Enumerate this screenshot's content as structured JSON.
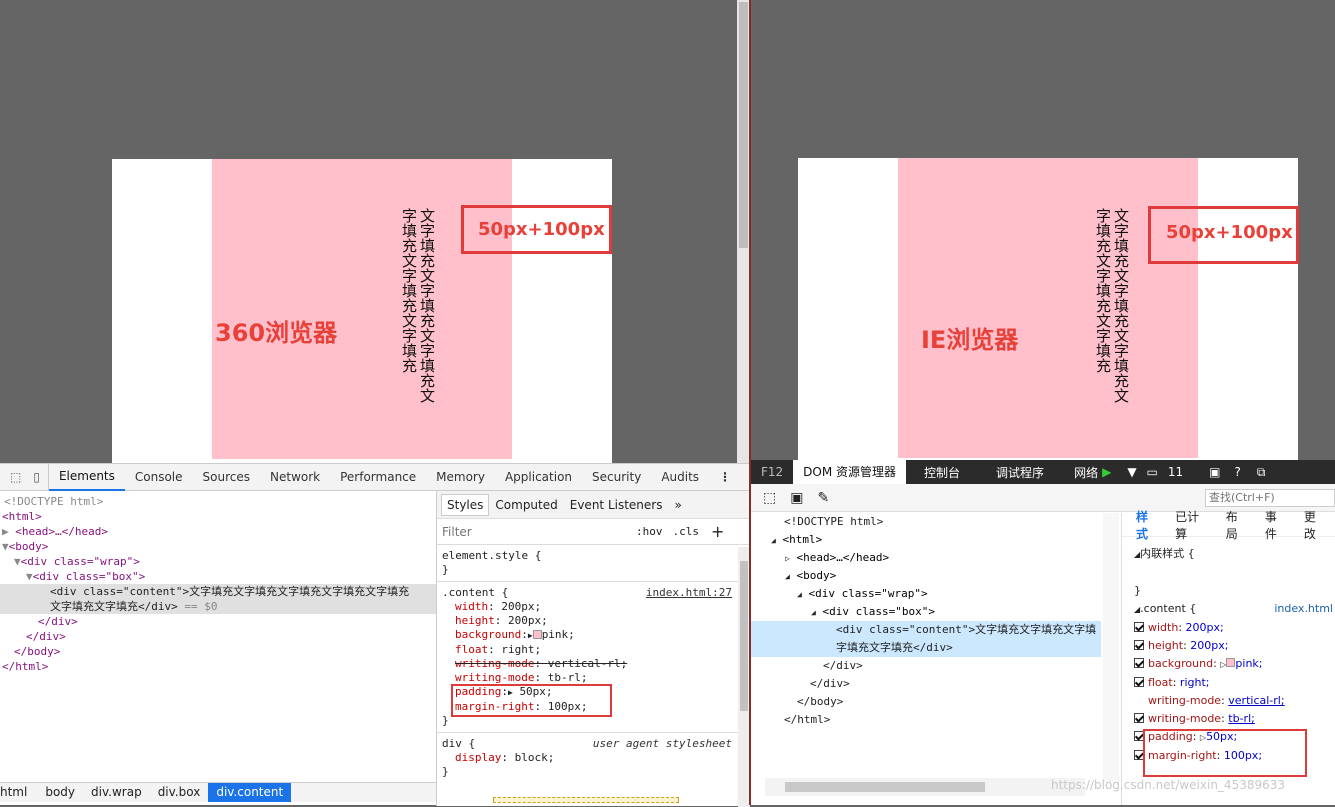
{
  "left": {
    "content_text": "文字填充文字填充文字填充文字填充文字填充文字填充",
    "label": "360浏览器",
    "annotation": "50px+100px",
    "devtools": {
      "tabs": [
        "Elements",
        "Console",
        "Sources",
        "Network",
        "Performance",
        "Memory",
        "Application",
        "Security",
        "Audits"
      ],
      "tree": {
        "doctype": "<!DOCTYPE html>",
        "html_open": "<html>",
        "head": "<head>…</head>",
        "body_open": "<body>",
        "wrap_open": "<div class=\"wrap\">",
        "box_open": "<div class=\"box\">",
        "content_line1": "<div class=\"content\">文字填充文字填充文字填充文字填充文字填充",
        "content_line2": "文字填充文字填充</div>",
        "selected_marker": "== $0",
        "div_close": "</div>",
        "body_close": "</body>",
        "html_close": "</html>"
      },
      "breadcrumbs": [
        "html",
        "body",
        "div.wrap",
        "div.box",
        "div.content"
      ],
      "styles_tabs": [
        "Styles",
        "Computed",
        "Event Listeners"
      ],
      "filter_placeholder": "Filter",
      "hov": ":hov",
      "cls": ".cls",
      "element_style": "element.style {",
      "rule_selector": ".content {",
      "rule_source": "index.html:27",
      "props": [
        {
          "name": "width",
          "value": "200px;"
        },
        {
          "name": "height",
          "value": "200px;"
        },
        {
          "name": "background",
          "value": "pink;"
        },
        {
          "name": "float",
          "value": "right;"
        },
        {
          "name": "writing-mode",
          "value": "vertical-rl;"
        },
        {
          "name": "writing-mode",
          "value": "tb-rl;"
        },
        {
          "name": "padding",
          "value": "50px;"
        },
        {
          "name": "margin-right",
          "value": "100px;"
        }
      ],
      "div_selector": "div {",
      "ua": "user agent stylesheet",
      "div_prop": "display",
      "div_val": "block;",
      "close_brace": "}"
    }
  },
  "right": {
    "content_text": "文字填充文字填充文字填充文字填充文字填充文字填充",
    "label": "IE浏览器",
    "annotation": "50px+100px",
    "devtools": {
      "f12": "F12",
      "tabs": [
        "DOM 资源管理器",
        "控制台",
        "调试程序",
        "网络"
      ],
      "count": "11",
      "search_placeholder": "查找(Ctrl+F)",
      "tree": {
        "doctype": "<!DOCTYPE html>",
        "html_open": "<html>",
        "head": "<head>…</head>",
        "body_open": "<body>",
        "wrap_open": "<div class=\"wrap\">",
        "box_open": "<div class=\"box\">",
        "content_line1": "<div class=\"content\">文字填充文字填充文字填",
        "content_line2": "字填充文字填充</div>",
        "div_close": "</div>",
        "body_close": "</body>",
        "html_close": "</html>"
      },
      "style_tabs": [
        "样式",
        "已计算",
        "布局",
        "事件",
        "更改"
      ],
      "inline_style": "内联样式 {",
      "rule_selector": ".content {",
      "rule_source": "index.html",
      "props": [
        {
          "name": "width",
          "value": "200px;"
        },
        {
          "name": "height",
          "value": "200px;"
        },
        {
          "name": "background",
          "value": "pink;"
        },
        {
          "name": "float",
          "value": "right;"
        },
        {
          "name": "writing-mode",
          "value": "vertical-rl;"
        },
        {
          "name": "writing-mode",
          "value": "tb-rl;"
        },
        {
          "name": "padding",
          "value": "50px;"
        },
        {
          "name": "margin-right",
          "value": "100px;"
        }
      ],
      "watermark": "https://blog.csdn.net/weixin_45389633"
    }
  },
  "colors": {
    "pink": "#ffc0cb",
    "annotation": "#e8413a",
    "chrome_blue": "#1a73e8",
    "ie_selected": "#cce8ff"
  }
}
